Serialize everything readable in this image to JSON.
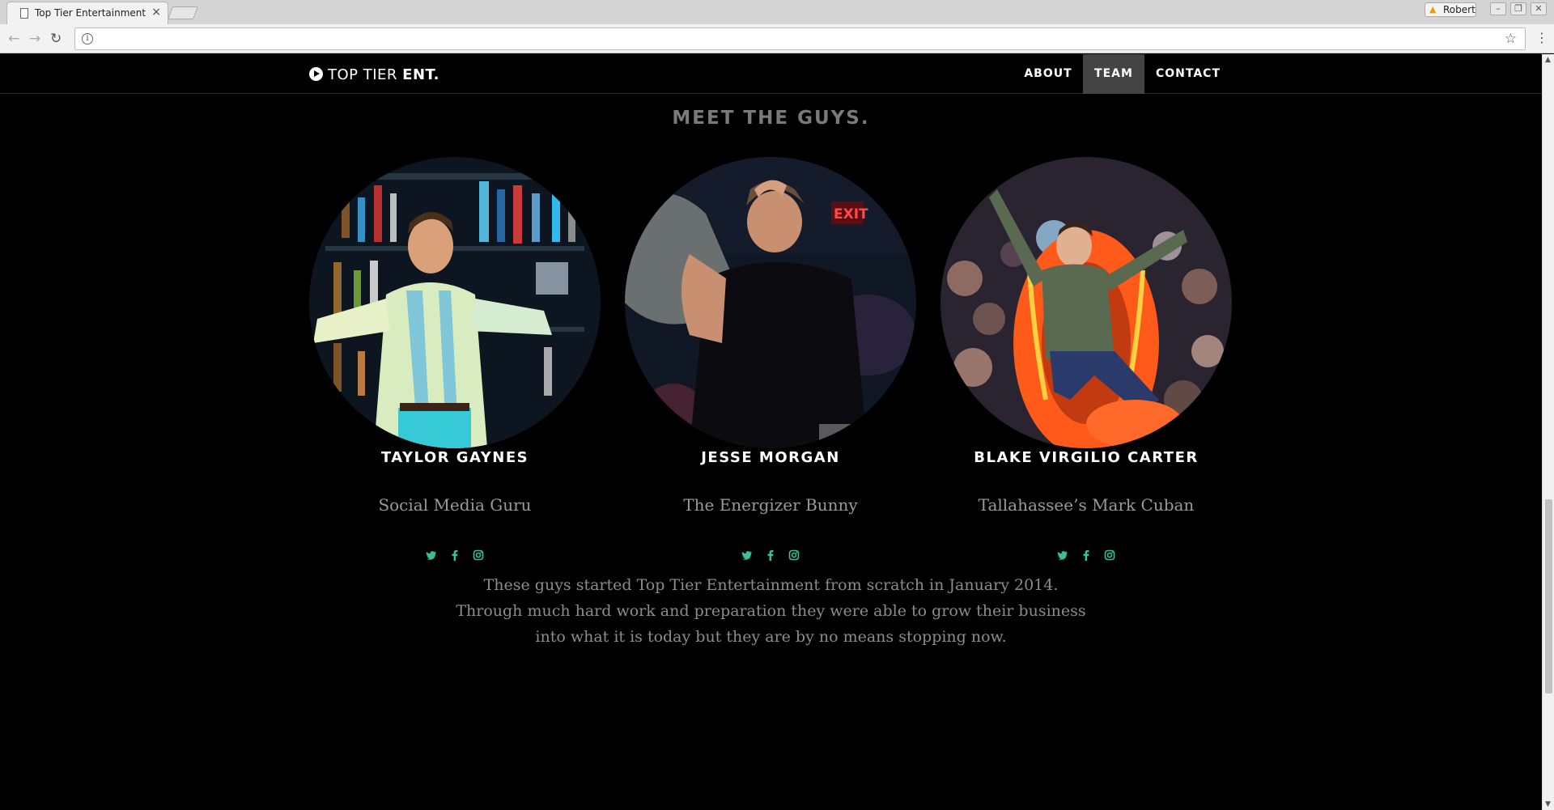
{
  "browser": {
    "tab_title": "Top Tier Entertainment",
    "tab_close": "×",
    "profile_name": "Robert",
    "address": ""
  },
  "site": {
    "logo_light": "TOP TIER",
    "logo_bold": "ENT.",
    "nav": [
      {
        "label": "ABOUT",
        "active": false
      },
      {
        "label": "TEAM",
        "active": true
      },
      {
        "label": "CONTACT",
        "active": false
      }
    ],
    "section_title": "MEET THE GUYS.",
    "team": [
      {
        "name": "TAYLOR GAYNES",
        "role": "Social Media Guru"
      },
      {
        "name": "JESSE MORGAN",
        "role": "The Energizer Bunny"
      },
      {
        "name": "BLAKE VIRGILIO CARTER",
        "role": "Tallahassee’s Mark Cuban"
      }
    ],
    "socials": [
      "twitter-icon",
      "facebook-icon",
      "instagram-icon"
    ],
    "blurb_lines": [
      "These guys started Top Tier Entertainment from scratch in January 2014.",
      "Through much hard work and preparation they were able to grow their business",
      "into what it is today but they are by no means stopping now."
    ]
  },
  "colors": {
    "background": "#000000",
    "accent": "#3bbf9a",
    "nav_active": "#444444",
    "muted_text": "#8c8c8c"
  }
}
